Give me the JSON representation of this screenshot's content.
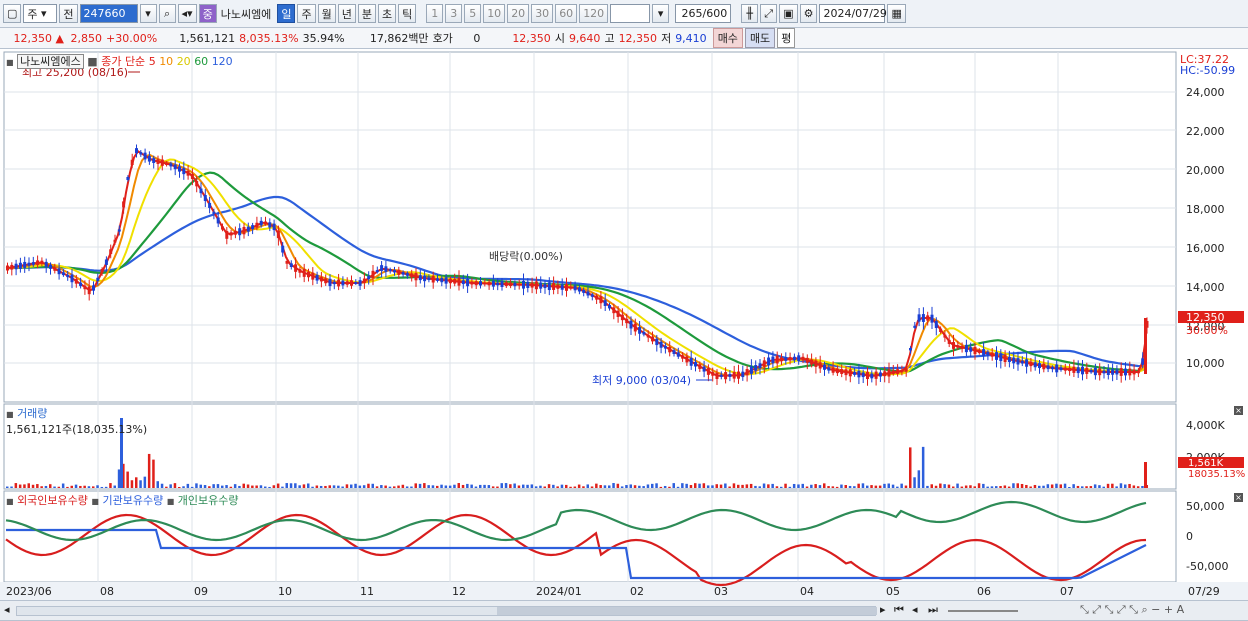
{
  "toolbar": {
    "market_type": "주",
    "prev_label": "전",
    "code": "247660",
    "stock_badge": "중",
    "stock_name": "나노씨엠에",
    "periods": [
      "일",
      "주",
      "월",
      "년",
      "분",
      "초",
      "틱"
    ],
    "active_period": "일",
    "intervals": [
      "1",
      "3",
      "5",
      "10",
      "20",
      "30",
      "60",
      "120"
    ],
    "count": "265",
    "count_max": "/600",
    "date": "2024/07/29"
  },
  "quote": {
    "price": "12,350",
    "change": "2,850",
    "change_pct": "+30.00%",
    "volume": "1,561,121",
    "volume_ratio": "8,035.13%",
    "turnover": "35.94%",
    "amount": "17,862백만",
    "bid_label": "호가",
    "bid_value": "0",
    "bid_price": "12,350",
    "open_label": "시",
    "open": "9,640",
    "high_label": "고",
    "high": "12,350",
    "low_label": "저",
    "low": "9,410",
    "buy": "매수",
    "sell": "매도",
    "eval": "평"
  },
  "price_panel": {
    "name": "나노씨엠에스",
    "ma_label": "종가 단순",
    "ma_periods": [
      "5",
      "10",
      "20",
      "60",
      "120"
    ],
    "ma_colors": [
      "#e0201a",
      "#f08a00",
      "#f0e000",
      "#1e9a3c",
      "#2d5fdc"
    ],
    "high_note": "최고 25,200 (08/16)",
    "low_note": "최저 9,000 (03/04)",
    "dividend_note": "배당락(0.00%)",
    "lc": "LC:37.22",
    "hc": "HC:-50.99",
    "current_price_tag": "12,350",
    "current_pct_tag": "30.00%",
    "y_ticks": [
      "24,000",
      "22,000",
      "20,000",
      "18,000",
      "16,000",
      "14,000",
      "12,000",
      "10,000"
    ]
  },
  "volume_panel": {
    "title": "거래량",
    "value": "1,561,121주(18,035.13%)",
    "y_ticks": [
      "4,000K",
      "2,000K"
    ],
    "current_tag": "1,561K",
    "current_sub": "18035.13%"
  },
  "holdings_panel": {
    "series": [
      "외국인보유수량",
      "기관보유수량",
      "개인보유수량"
    ],
    "colors": [
      "#d81e1e",
      "#2d5fdc",
      "#2e8b57"
    ],
    "y_ticks": [
      "50,000",
      "0",
      "-50,000"
    ]
  },
  "x_axis": {
    "labels": [
      "2023/06",
      "08",
      "09",
      "10",
      "11",
      "12",
      "2024/01",
      "02",
      "03",
      "04",
      "05",
      "06",
      "07"
    ],
    "right_label": "07/29"
  }
}
